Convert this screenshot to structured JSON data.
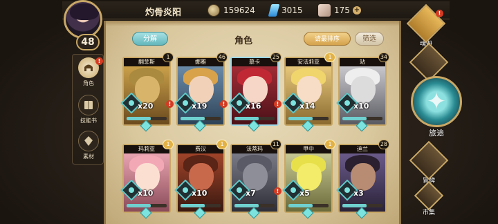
{
  "header": {
    "player_name": "灼骨炎阳",
    "level": "48",
    "resources": [
      {
        "name": "gold",
        "value": "159624"
      },
      {
        "name": "crystal",
        "value": "3015"
      },
      {
        "name": "stone",
        "value": "175"
      }
    ],
    "plus_icon": "+"
  },
  "left_tabs": [
    {
      "label": "角色",
      "icon": "helmet-icon",
      "alert": "!"
    },
    {
      "label": "技能书",
      "icon": "book-icon"
    },
    {
      "label": "素材",
      "icon": "material-icon"
    }
  ],
  "panel": {
    "title": "角色",
    "decompose_label": "分解",
    "sort_label": "请最排序",
    "filter_label": "筛选"
  },
  "cards": [
    {
      "name": "翻菲斯",
      "badge": "1",
      "count": "x20",
      "alert": "!"
    },
    {
      "name": "娜雅",
      "badge": "46",
      "count": "x19",
      "alert": "!"
    },
    {
      "name": "慕卡",
      "badge": "25",
      "count": "x16",
      "alert": "!"
    },
    {
      "name": "安法莉亚",
      "badge": "1",
      "count": "x14"
    },
    {
      "name": "站",
      "badge": "34",
      "count": "x10"
    },
    {
      "name": "玛莉亚",
      "badge": "1",
      "count": "x10"
    },
    {
      "name": "费汉",
      "badge": "1",
      "count": "x10"
    },
    {
      "name": "法蒂玛",
      "badge": "11",
      "count": "x7",
      "alert": "!"
    },
    {
      "name": "甲中",
      "badge": "1",
      "count": "x5"
    },
    {
      "name": "迪兰",
      "badge": "28",
      "count": "x3"
    }
  ],
  "right_nav": [
    {
      "label": "魂册",
      "alert": "!"
    },
    {
      "label": "公会"
    },
    {
      "label": "旅途"
    },
    {
      "label": "冒牌"
    },
    {
      "label": "市集"
    }
  ],
  "colors": {
    "accent_teal": "#6fd0cf",
    "gold": "#c9a866",
    "alert_red": "#d43b22"
  }
}
